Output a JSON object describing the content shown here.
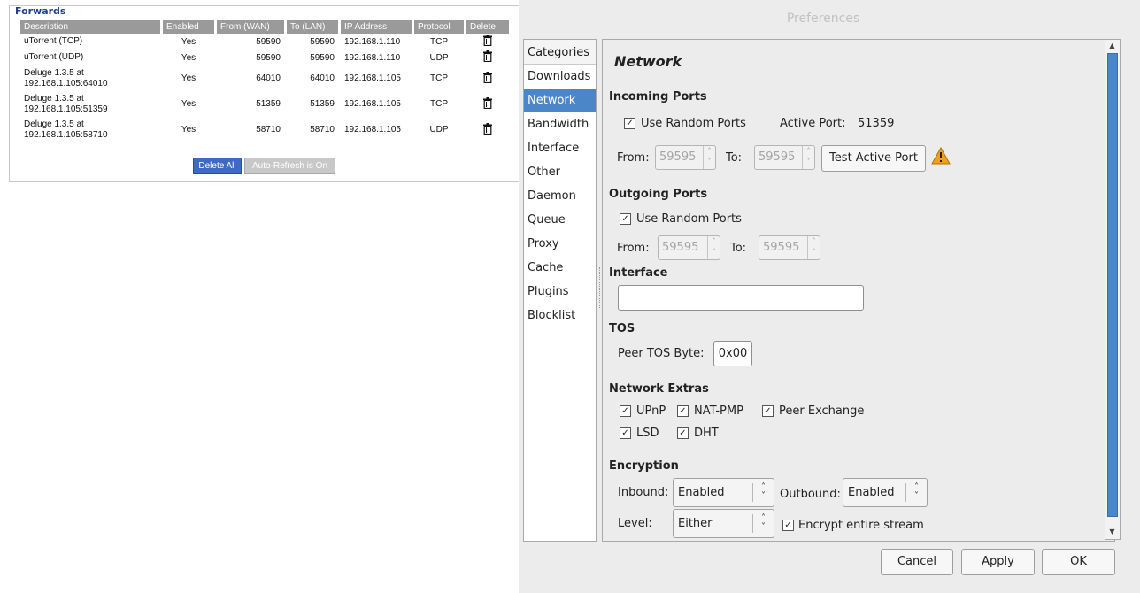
{
  "forwards": {
    "title": "Forwards",
    "columns": [
      "Description",
      "Enabled",
      "From (WAN)",
      "To (LAN)",
      "IP Address",
      "Protocol",
      "Delete"
    ],
    "rows": [
      {
        "desc1": "uTorrent (TCP)",
        "desc2": "",
        "enabled": "Yes",
        "from": "59590",
        "to": "59590",
        "ip": "192.168.1.110",
        "proto": "TCP"
      },
      {
        "desc1": "uTorrent (UDP)",
        "desc2": "",
        "enabled": "Yes",
        "from": "59590",
        "to": "59590",
        "ip": "192.168.1.110",
        "proto": "UDP"
      },
      {
        "desc1": "Deluge 1.3.5 at",
        "desc2": "192.168.1.105:64010",
        "enabled": "Yes",
        "from": "64010",
        "to": "64010",
        "ip": "192.168.1.105",
        "proto": "TCP"
      },
      {
        "desc1": "Deluge 1.3.5 at",
        "desc2": "192.168.1.105:51359",
        "enabled": "Yes",
        "from": "51359",
        "to": "51359",
        "ip": "192.168.1.105",
        "proto": "TCP"
      },
      {
        "desc1": "Deluge 1.3.5 at",
        "desc2": "192.168.1.105:58710",
        "enabled": "Yes",
        "from": "58710",
        "to": "58710",
        "ip": "192.168.1.105",
        "proto": "UDP"
      }
    ],
    "delete_all_label": "Delete All",
    "auto_refresh_label": "Auto-Refresh is On"
  },
  "preferences": {
    "title": "Preferences",
    "categories_header": "Categories",
    "categories": [
      "Downloads",
      "Network",
      "Bandwidth",
      "Interface",
      "Other",
      "Daemon",
      "Queue",
      "Proxy",
      "Cache",
      "Plugins",
      "Blocklist"
    ],
    "selected_category": "Network",
    "page_title": "Network",
    "incoming": {
      "title": "Incoming Ports",
      "use_random_label": "Use Random Ports",
      "use_random_checked": true,
      "active_port_label": "Active Port:",
      "active_port_value": "51359",
      "from_label": "From:",
      "from_value": "59595",
      "to_label": "To:",
      "to_value": "59595",
      "test_button": "Test Active Port"
    },
    "outgoing": {
      "title": "Outgoing Ports",
      "use_random_label": "Use Random Ports",
      "use_random_checked": true,
      "from_label": "From:",
      "from_value": "59595",
      "to_label": "To:",
      "to_value": "59595"
    },
    "interface": {
      "title": "Interface",
      "value": ""
    },
    "tos": {
      "title": "TOS",
      "label": "Peer TOS Byte:",
      "value": "0x00"
    },
    "extras": {
      "title": "Network Extras",
      "upnp": "UPnP",
      "natpmp": "NAT-PMP",
      "peer_exchange": "Peer Exchange",
      "lsd": "LSD",
      "dht": "DHT"
    },
    "encryption": {
      "title": "Encryption",
      "inbound_label": "Inbound:",
      "inbound_value": "Enabled",
      "outbound_label": "Outbound:",
      "outbound_value": "Enabled",
      "level_label": "Level:",
      "level_value": "Either",
      "encrypt_entire_label": "Encrypt entire stream"
    },
    "buttons": {
      "cancel": "Cancel",
      "apply": "Apply",
      "ok": "OK"
    },
    "colors": {
      "selection": "#4a86c8",
      "warning": "#f0a020"
    }
  }
}
